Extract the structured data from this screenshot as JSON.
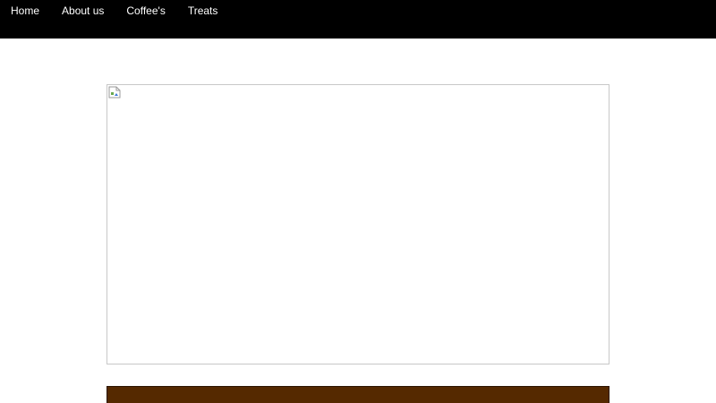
{
  "nav": {
    "items": [
      {
        "label": "Home"
      },
      {
        "label": "About us"
      },
      {
        "label": "Coffee's"
      },
      {
        "label": "Treats"
      }
    ]
  },
  "hero": {
    "image_state": "broken",
    "icon": "broken-image-icon"
  },
  "colors": {
    "nav_background": "#000000",
    "nav_text": "#ffffff",
    "content_bar": "#552900"
  }
}
